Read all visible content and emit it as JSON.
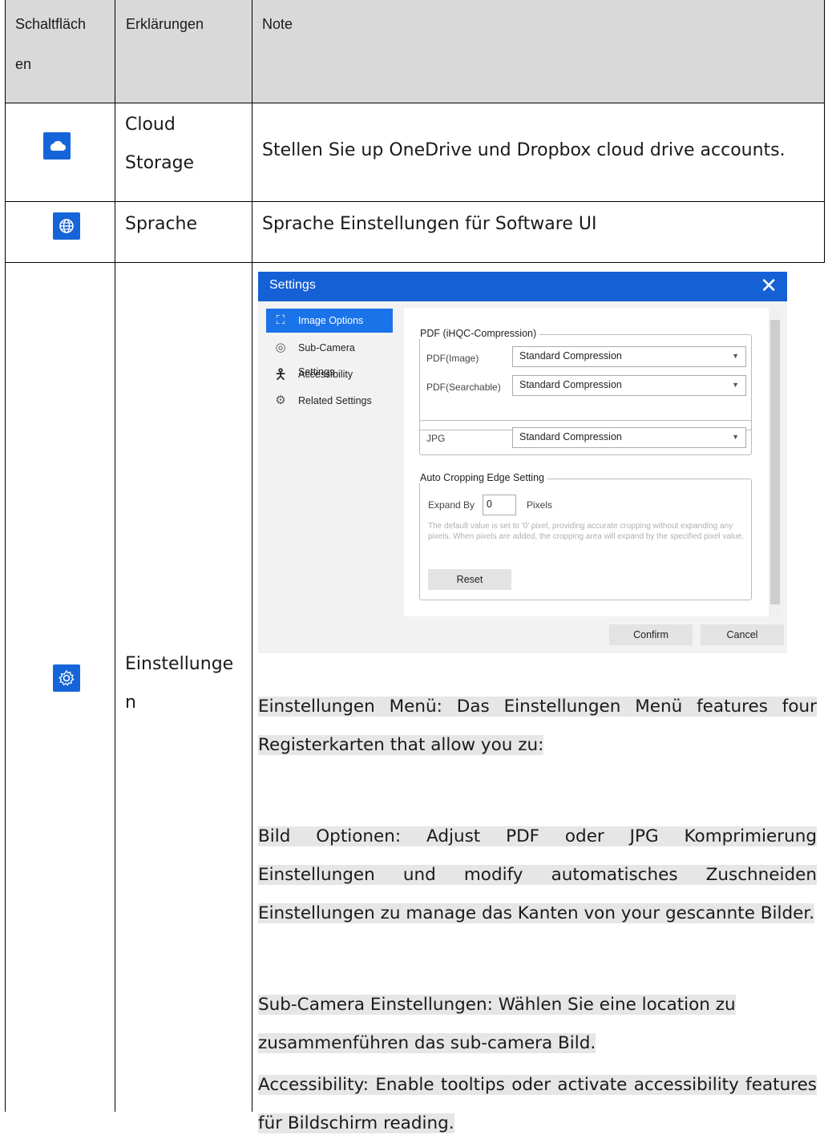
{
  "header": {
    "col1": "Schaltfläch",
    "col1_cont": "en",
    "col2": "Erklärungen",
    "col3": "Note"
  },
  "rows": [
    {
      "icon": "cloud-icon",
      "name_line1": "Cloud",
      "name_line2": "Storage",
      "note": "Stellen Sie up OneDrive und Dropbox cloud drive accounts."
    },
    {
      "icon": "globe-icon",
      "name": "Sprache",
      "note": "Sprache Einstellungen für Software UI"
    },
    {
      "icon": "gear-icon",
      "name_line1": "Einstellunge",
      "name_line2": "n",
      "paragraphs": {
        "p1": "Einstellungen Menü: Das Einstellungen Menü features four Registerkarten that allow you zu:",
        "p2": "Bild Optionen: Adjust PDF oder JPG Komprimierung Einstellungen und modify automatisches Zuschneiden Einstellungen zu manage das Kanten von your gescannte Bilder.",
        "p3": "Sub-Camera Einstellungen: Wählen Sie eine location zu zusammenführen das sub-camera Bild.",
        "p4": "Accessibility: Enable tooltips oder activate accessibility features für Bildschirm reading."
      }
    }
  ],
  "dialog": {
    "title": "Settings",
    "close": "✕",
    "nav": [
      {
        "label": "Image Options",
        "icon": "image-icon",
        "active": true
      },
      {
        "label": "Sub-Camera Settings",
        "icon": "camera-icon",
        "active": false
      },
      {
        "label": "Accessibility",
        "icon": "accessibility-icon",
        "active": false
      },
      {
        "label": "Related Settings",
        "icon": "gear-icon",
        "active": false
      }
    ],
    "pdf_group": "PDF (iHQC-Compression)",
    "pdf_image_label": "PDF(Image)",
    "pdf_image_value": "Standard Compression",
    "pdf_searchable_label": "PDF(Searchable)",
    "pdf_searchable_value": "Standard Compression",
    "jpg_label": "JPG",
    "jpg_value": "Standard Compression",
    "crop_group": "Auto Cropping Edge Setting",
    "expand_label": "Expand By",
    "expand_value": "0",
    "expand_unit": "Pixels",
    "crop_hint": "The default value is set to '0' pixel, providing accurate cropping without expanding any pixels. When pixels are added, the cropping area will expand by the specified pixel value.",
    "reset": "Reset",
    "confirm": "Confirm",
    "cancel": "Cancel"
  }
}
